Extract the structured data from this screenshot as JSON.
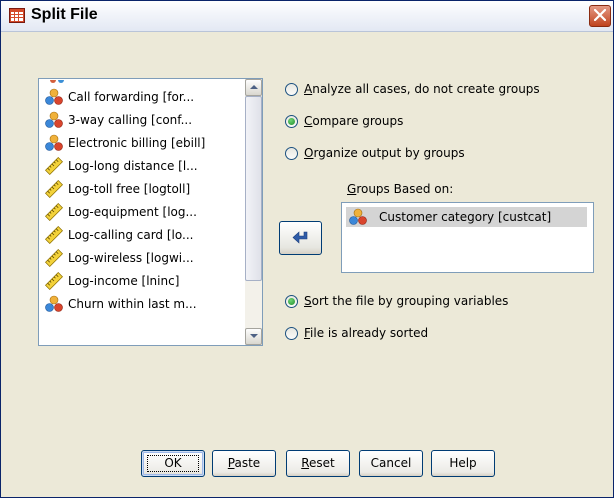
{
  "window": {
    "title": "Split File"
  },
  "variables_list": {
    "items": [
      {
        "label": "Call forwarding [for...",
        "icon": "nominal-icon"
      },
      {
        "label": "3-way calling [conf...",
        "icon": "nominal-icon"
      },
      {
        "label": "Electronic billing [ebill]",
        "icon": "nominal-icon"
      },
      {
        "label": "Log-long distance [l...",
        "icon": "scale-icon"
      },
      {
        "label": "Log-toll free [logtoll]",
        "icon": "scale-icon"
      },
      {
        "label": "Log-equipment [log...",
        "icon": "scale-icon"
      },
      {
        "label": "Log-calling card [lo...",
        "icon": "scale-icon"
      },
      {
        "label": "Log-wireless [logwi...",
        "icon": "scale-icon"
      },
      {
        "label": "Log-income [lninc]",
        "icon": "scale-icon"
      },
      {
        "label": "Churn within last m...",
        "icon": "nominal-icon"
      }
    ]
  },
  "mode_options": {
    "analyze_all": {
      "label_u": "A",
      "label_rest": "nalyze all cases, do not create groups",
      "checked": false
    },
    "compare": {
      "label_u": "C",
      "label_rest": "ompare groups",
      "checked": true
    },
    "organize": {
      "label_u": "O",
      "label_rest": "rganize output by groups",
      "checked": false
    }
  },
  "groups": {
    "label_u": "G",
    "label_rest": "roups Based on:",
    "items": [
      {
        "label": "Customer category [custcat]",
        "icon": "nominal-icon"
      }
    ]
  },
  "sort_options": {
    "sort_file": {
      "label_u": "S",
      "label_rest": "ort the file by grouping variables",
      "checked": true
    },
    "already_sorted": {
      "label_u": "F",
      "label_rest": "ile is already sorted",
      "checked": false
    }
  },
  "buttons": {
    "ok": "OK",
    "paste_u": "P",
    "paste_rest": "aste",
    "reset_u": "R",
    "reset_rest": "eset",
    "cancel": "Cancel",
    "help": "Help"
  },
  "colors": {
    "title_close_red": "#c0441f",
    "selected_item_bg": "#d4d4d4",
    "radio_checked_green": "#1f8d2a"
  }
}
